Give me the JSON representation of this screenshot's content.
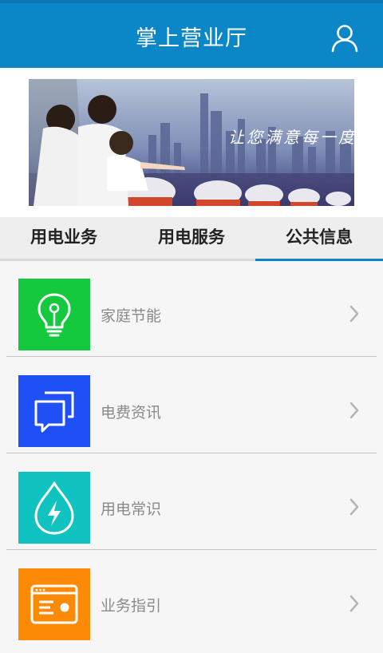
{
  "header": {
    "title": "掌上营业厅",
    "user_icon": "user-icon"
  },
  "banner": {
    "slogan": "让您满意每一度"
  },
  "tabs": [
    {
      "label": "用电业务",
      "active": false
    },
    {
      "label": "用电服务",
      "active": false
    },
    {
      "label": "公共信息",
      "active": true
    }
  ],
  "items": [
    {
      "label": "家庭节能",
      "icon": "lightbulb-icon",
      "color": "#14c93e"
    },
    {
      "label": "电费资讯",
      "icon": "chat-bubbles-icon",
      "color": "#1f50f5"
    },
    {
      "label": "用电常识",
      "icon": "lightning-drop-icon",
      "color": "#10c2c0"
    },
    {
      "label": "业务指引",
      "icon": "browser-window-icon",
      "color": "#fd8a05"
    }
  ],
  "colors": {
    "header": "#0b86c6",
    "tab_indicator": "#0b86c6"
  }
}
